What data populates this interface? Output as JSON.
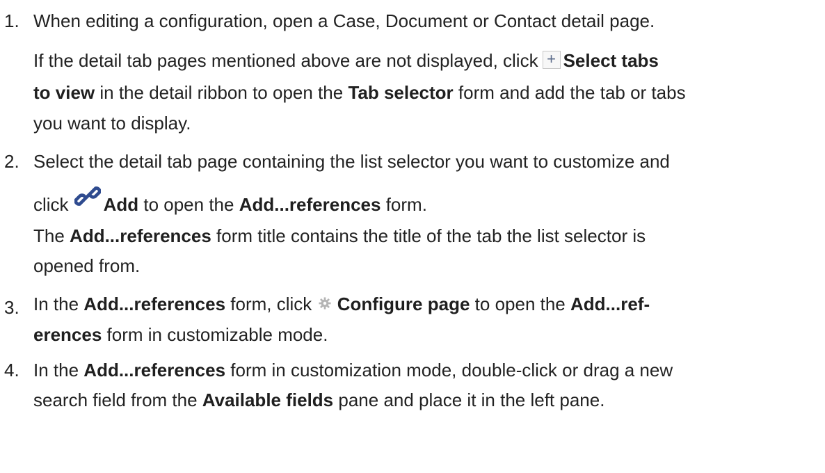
{
  "steps": [
    {
      "num": "1.",
      "main": "When editing a configuration, open a Case, Document or Contact detail page.",
      "note": {
        "t1": "If the detail tab pages mentioned above are not displayed, click",
        "b1": "Select tabs",
        "b1b": "to view",
        "t2": "in the detail ribbon to open the",
        "b2": "Tab selector",
        "t3": "form and add the tab or tabs",
        "t4": "you want to display."
      }
    },
    {
      "num": "2.",
      "t1": "Select the detail tab page containing the list selector you want to customize and",
      "t2": "click",
      "b1": "Add",
      "t3": "to open the",
      "b2": "Add...references",
      "t4": "form.",
      "note": {
        "t1": "The",
        "b1": "Add...references",
        "t2": "form title contains the title of the tab the list selector is",
        "t3": "opened from."
      }
    },
    {
      "num": "3.",
      "t1": "In the",
      "b1": "Add...references",
      "t2": "form, click",
      "b2": "Configure page",
      "t3": "to open the",
      "b3": "Add...ref-",
      "b3b": "erences",
      "t4": "form in customizable mode."
    },
    {
      "num": "4.",
      "t1": "In the",
      "b1": "Add...references",
      "t2": "form in customization mode, double-click or drag a new",
      "t3": "search field from the",
      "b2": "Available fields",
      "t4": "pane and place it in the left pane."
    }
  ],
  "icons": {
    "plus_glyph": "+",
    "link_color": "#2f4b8f",
    "gear_color": "#b5b5b5"
  }
}
